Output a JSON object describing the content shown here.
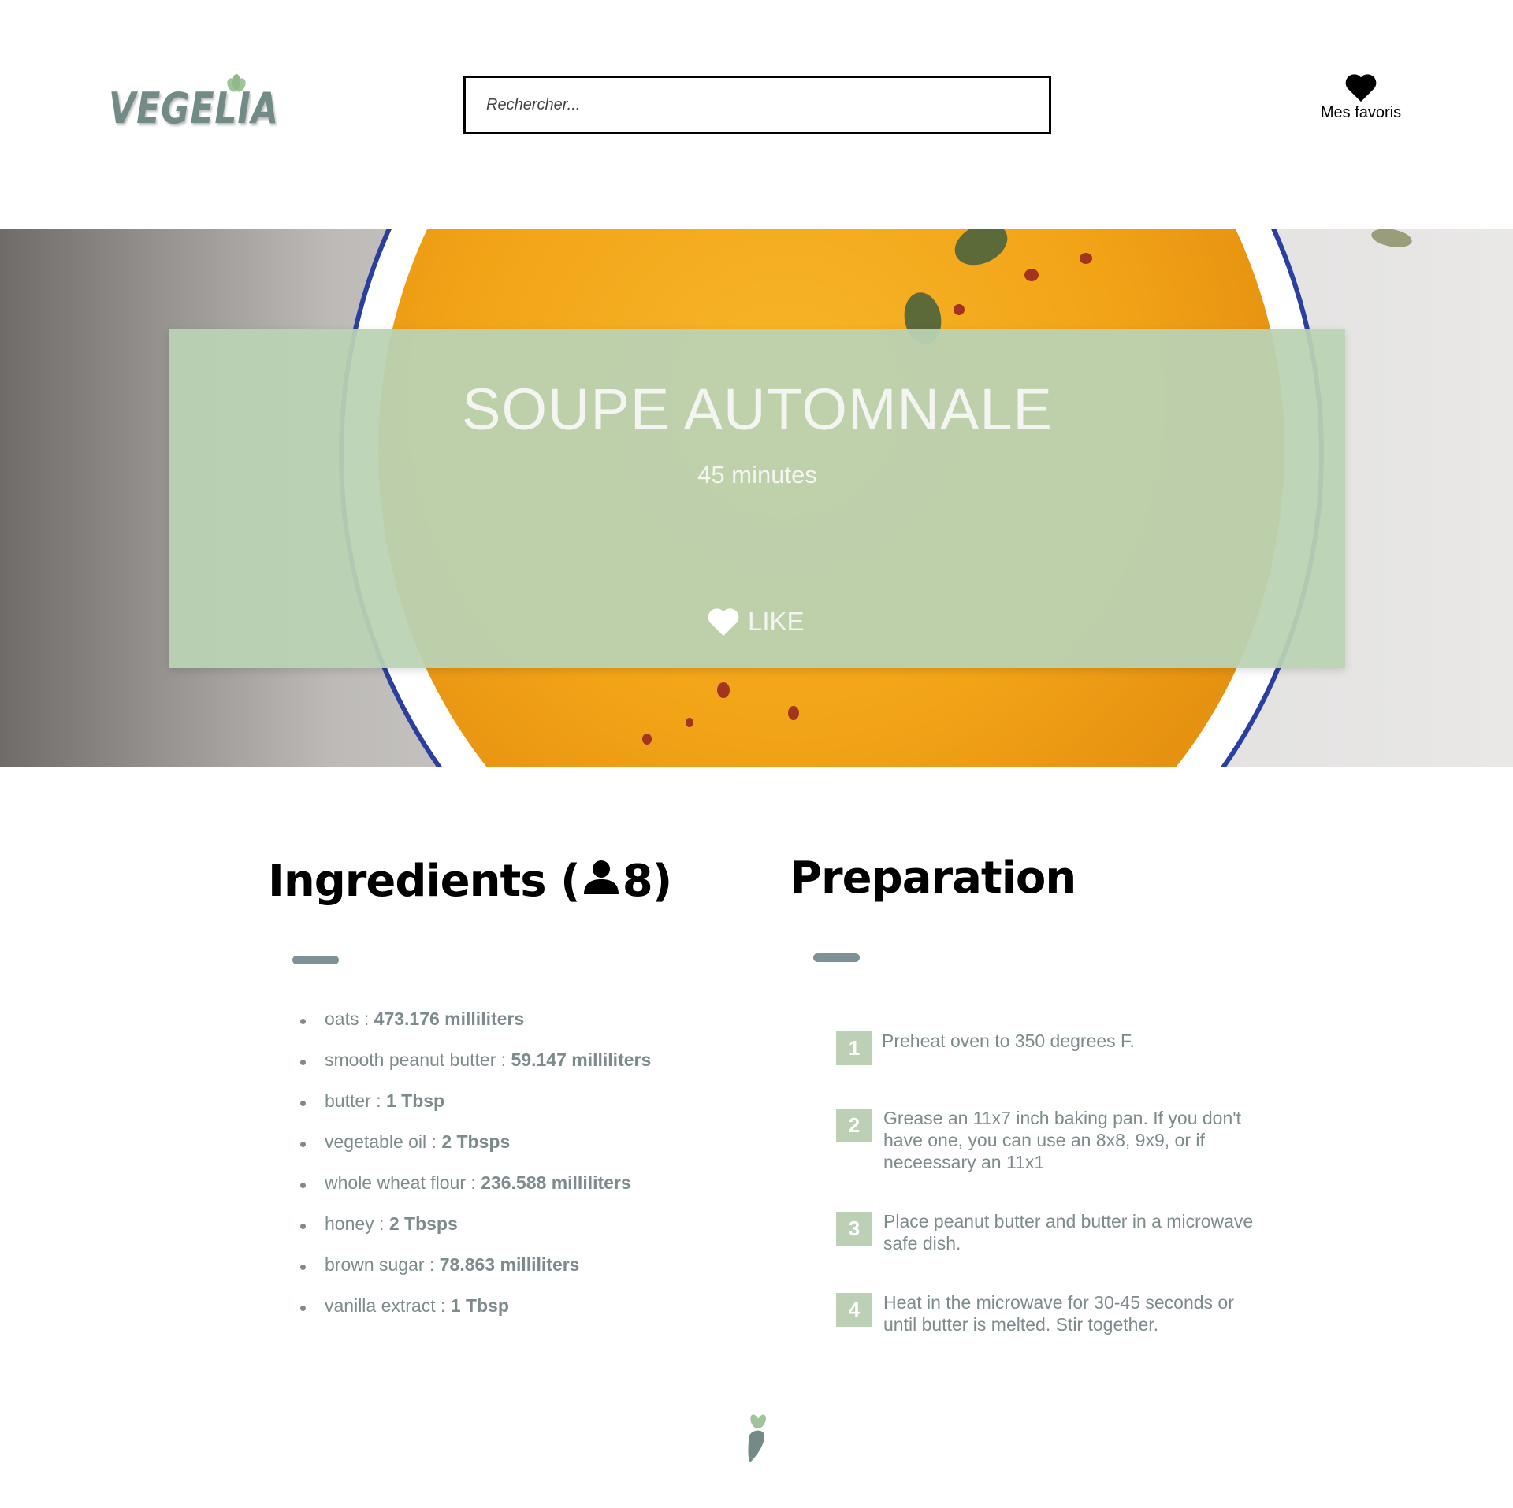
{
  "header": {
    "logo_text": "VEGELIA",
    "search_placeholder": "Rechercher...",
    "favorites_label": "Mes favoris"
  },
  "hero": {
    "title": "SOUPE AUTOMNALE",
    "duration": "45 minutes",
    "like_label": "LIKE"
  },
  "ingredients": {
    "title_prefix": "Ingredients (",
    "servings": "8)",
    "items": [
      {
        "name": "oats : ",
        "qty": "473.176 milliliters"
      },
      {
        "name": "smooth peanut butter : ",
        "qty": "59.147 milliliters"
      },
      {
        "name": "butter : ",
        "qty": "1 Tbsp"
      },
      {
        "name": "vegetable oil : ",
        "qty": "2 Tbsps"
      },
      {
        "name": "whole wheat flour : ",
        "qty": "236.588 milliliters"
      },
      {
        "name": "honey : ",
        "qty": "2 Tbsps"
      },
      {
        "name": "brown sugar : ",
        "qty": "78.863 milliliters"
      },
      {
        "name": "vanilla extract : ",
        "qty": "1 Tbsp"
      }
    ]
  },
  "preparation": {
    "title": "Preparation",
    "steps": [
      {
        "num": "1",
        "text": "Preheat oven to 350 degrees F."
      },
      {
        "num": "2",
        "text": "Grease an 11x7 inch baking pan. If you don't have one, you can use an 8x8, 9x9, or if neceessary an 11x1"
      },
      {
        "num": "3",
        "text": "Place peanut butter and butter in a microwave safe dish."
      },
      {
        "num": "4",
        "text": "Heat in the microwave for 30-45 seconds or until butter is melted. Stir together."
      }
    ]
  },
  "colors": {
    "brand": "#728b87",
    "overlay": "#bad2b4",
    "step_badge": "#bcd0b6",
    "muted_text": "#7e8b8c"
  },
  "icons": {
    "logo_leaf": "leaf-icon",
    "favorites": "heart-icon",
    "like": "heart-icon",
    "servings": "person-icon",
    "footer": "carrot-icon"
  }
}
